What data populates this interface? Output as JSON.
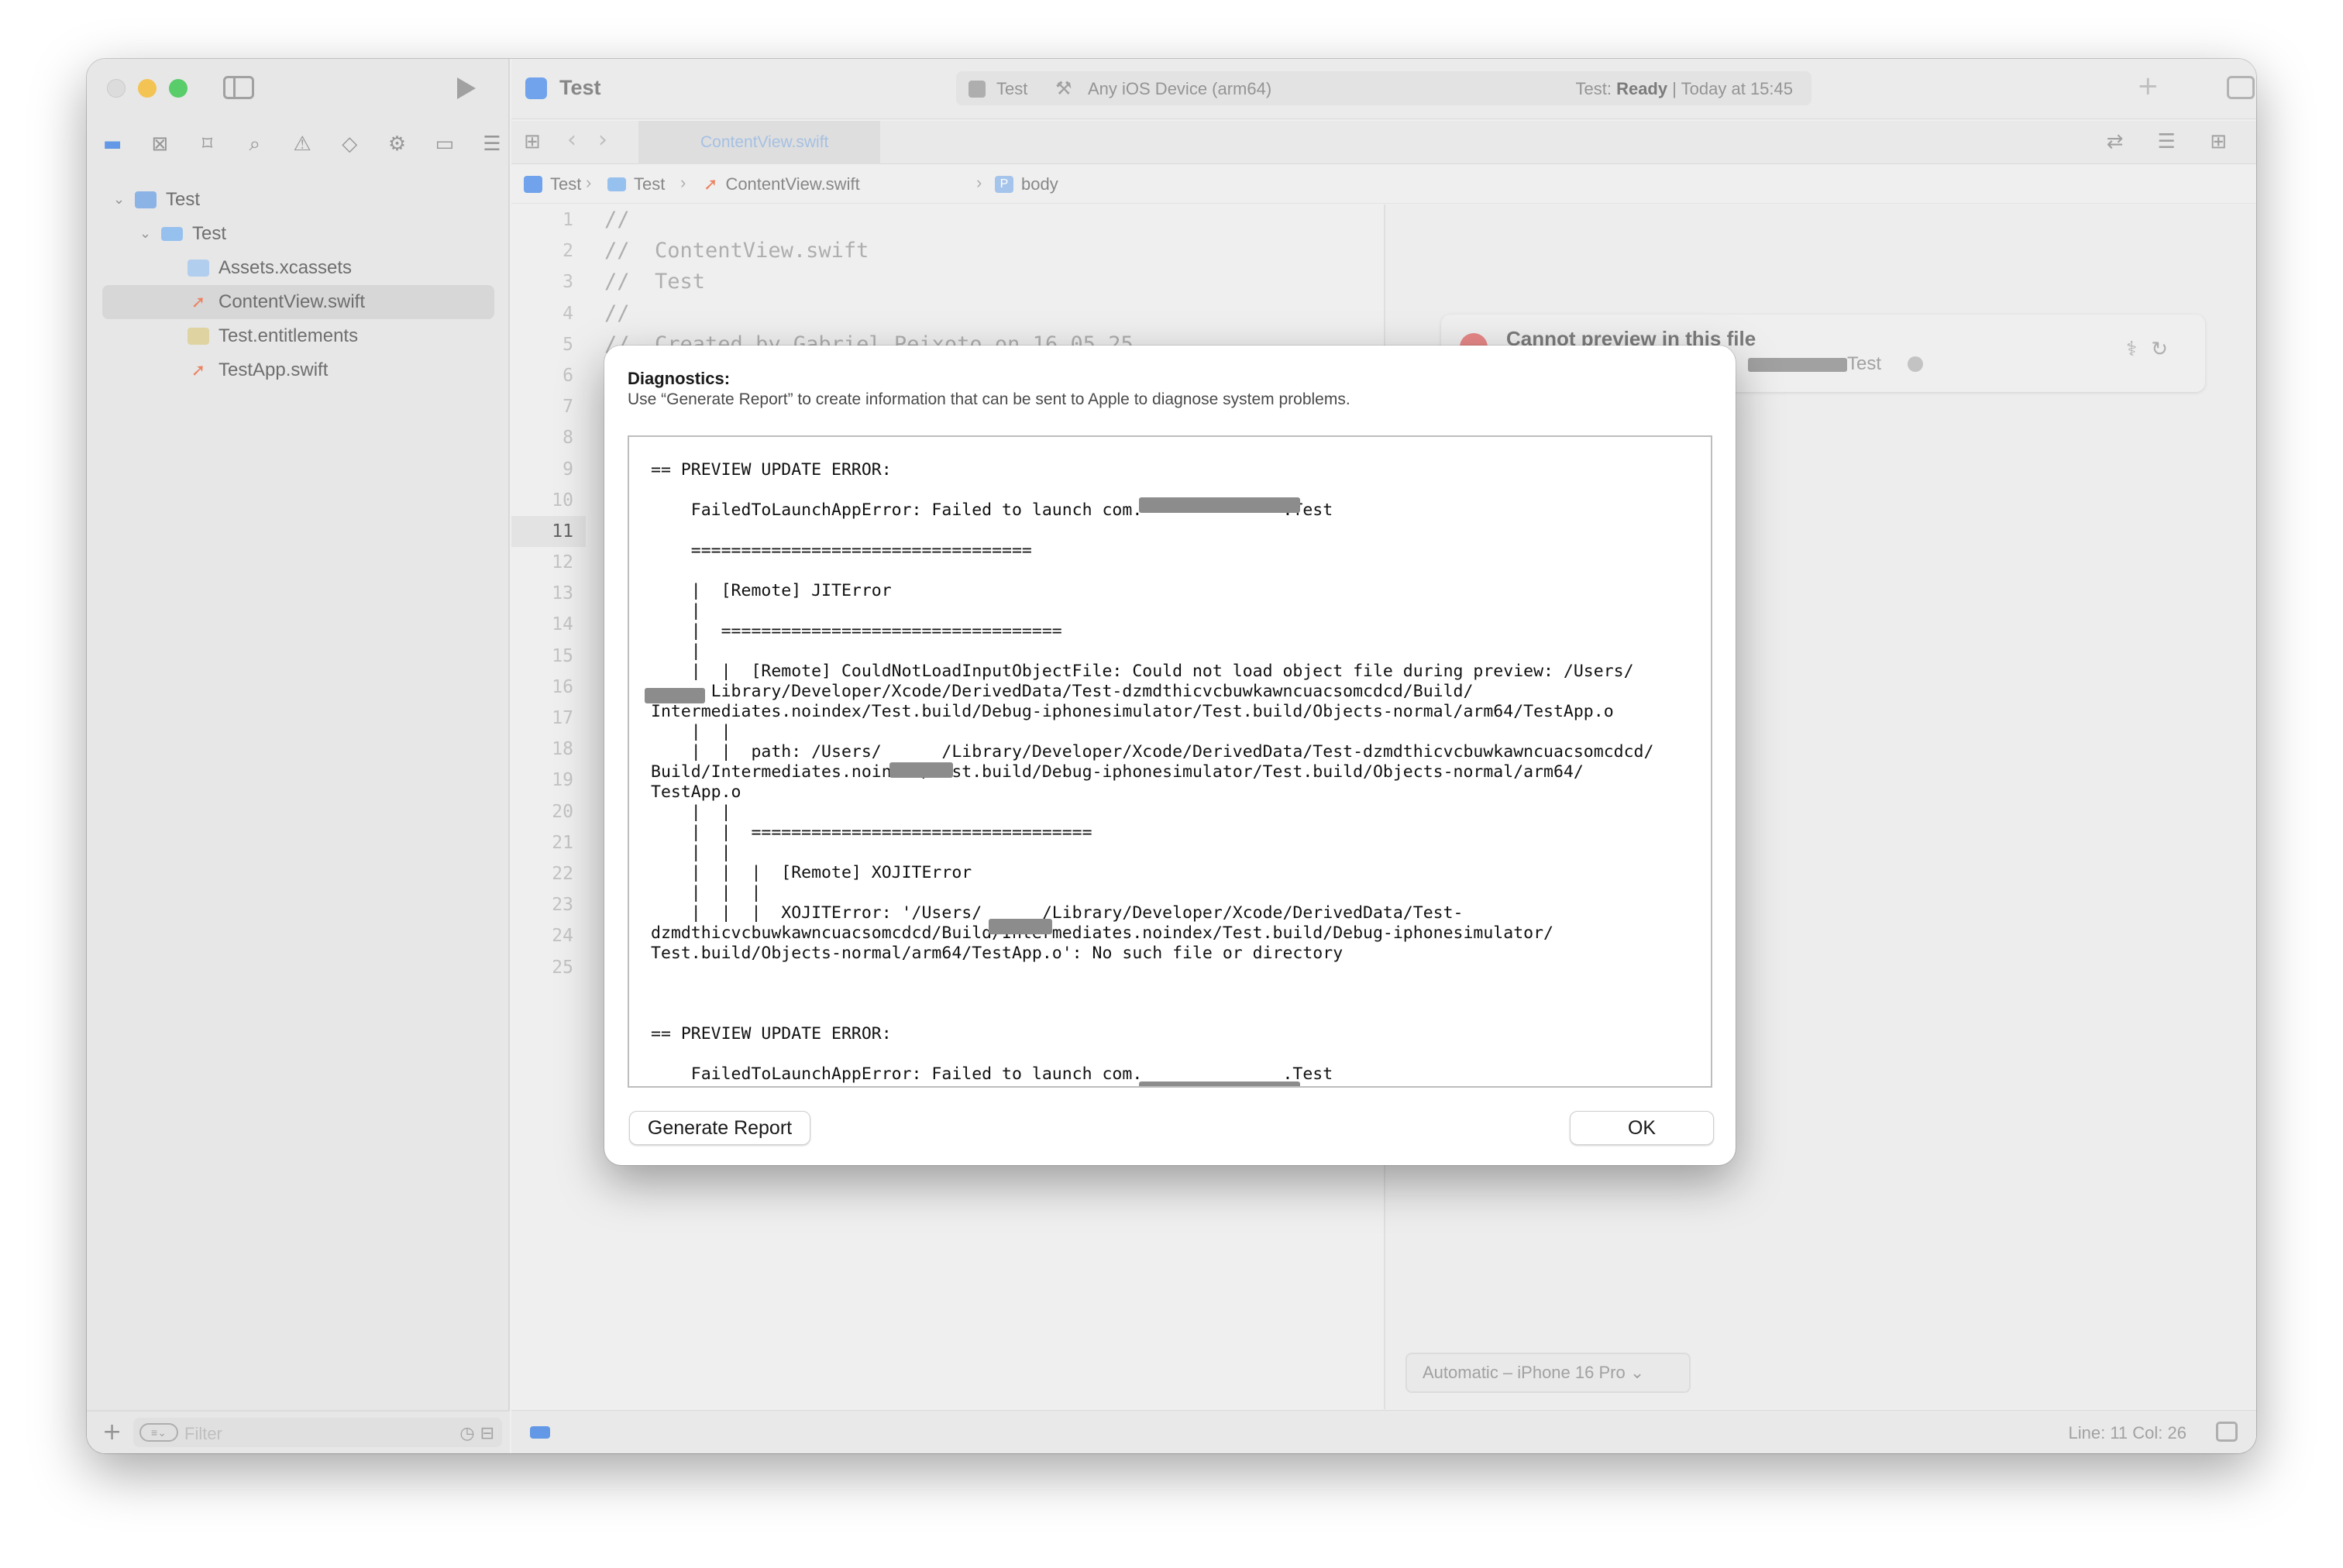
{
  "sidebar": {
    "tree": [
      {
        "label": "Test",
        "kind": "proj",
        "depth": 0,
        "disclosure": "⌄"
      },
      {
        "label": "Test",
        "kind": "folder",
        "depth": 1,
        "disclosure": "⌄"
      },
      {
        "label": "Assets.xcassets",
        "kind": "assets",
        "depth": 2
      },
      {
        "label": "ContentView.swift",
        "kind": "swift",
        "depth": 2,
        "selected": true
      },
      {
        "label": "Test.entitlements",
        "kind": "ent",
        "depth": 2
      },
      {
        "label": "TestApp.swift",
        "kind": "swift",
        "depth": 2
      }
    ],
    "filter_placeholder": "Filter"
  },
  "toolbar": {
    "project_title": "Test",
    "scheme": "Test",
    "device": "Any iOS Device (arm64)",
    "status_prefix": "Test: ",
    "status_state": "Ready",
    "status_suffix": " | Today at 15:45"
  },
  "tab": {
    "label": "ContentView.swift"
  },
  "jumpbar": {
    "items": [
      "Test",
      "Test",
      "ContentView.swift",
      "body"
    ]
  },
  "editor": {
    "current_line": 11,
    "line_count": 25,
    "code_lines": [
      "//",
      "//  ContentView.swift",
      "//  Test",
      "//",
      "//  Created by Gabriel Peixoto on 16.05.25"
    ]
  },
  "canvas": {
    "preview_title": "Cannot preview in this file",
    "preview_subtitle": "Test",
    "device_selector": "Automatic – iPhone 16 Pro ⌄"
  },
  "statusbar": {
    "line_col": "Line: 11  Col: 26"
  },
  "dialog": {
    "title": "Diagnostics:",
    "description": "Use “Generate Report” to create information that can be sent to Apple to diagnose system problems.",
    "log": "== PREVIEW UPDATE ERROR:\n\n    FailedToLaunchAppError: Failed to launch com.              .Test\n\n    ==================================\n\n    |  [Remote] JITError\n    |\n    |  ==================================\n    |\n    |  |  [Remote] CouldNotLoadInputObjectFile: Could not load object file during preview: /Users/\n      Library/Developer/Xcode/DerivedData/Test-dzmdthicvcbuwkawncuacsomcdcd/Build/\nIntermediates.noindex/Test.build/Debug-iphonesimulator/Test.build/Objects-normal/arm64/TestApp.o\n    |  |\n    |  |  path: /Users/      /Library/Developer/Xcode/DerivedData/Test-dzmdthicvcbuwkawncuacsomcdcd/\nBuild/Intermediates.noindex/Test.build/Debug-iphonesimulator/Test.build/Objects-normal/arm64/\nTestApp.o\n    |  |\n    |  |  ==================================\n    |  |\n    |  |  |  [Remote] XOJITError\n    |  |  |\n    |  |  |  XOJITError: '/Users/      /Library/Developer/Xcode/DerivedData/Test-\ndzmdthicvcbuwkawncuacsomcdcd/Build/Intermediates.noindex/Test.build/Debug-iphonesimulator/\nTest.build/Objects-normal/arm64/TestApp.o': No such file or directory\n\n\n\n== PREVIEW UPDATE ERROR:\n\n    FailedToLaunchAppError: Failed to launch com.              .Test",
    "generate_report_label": "Generate Report",
    "ok_label": "OK"
  }
}
